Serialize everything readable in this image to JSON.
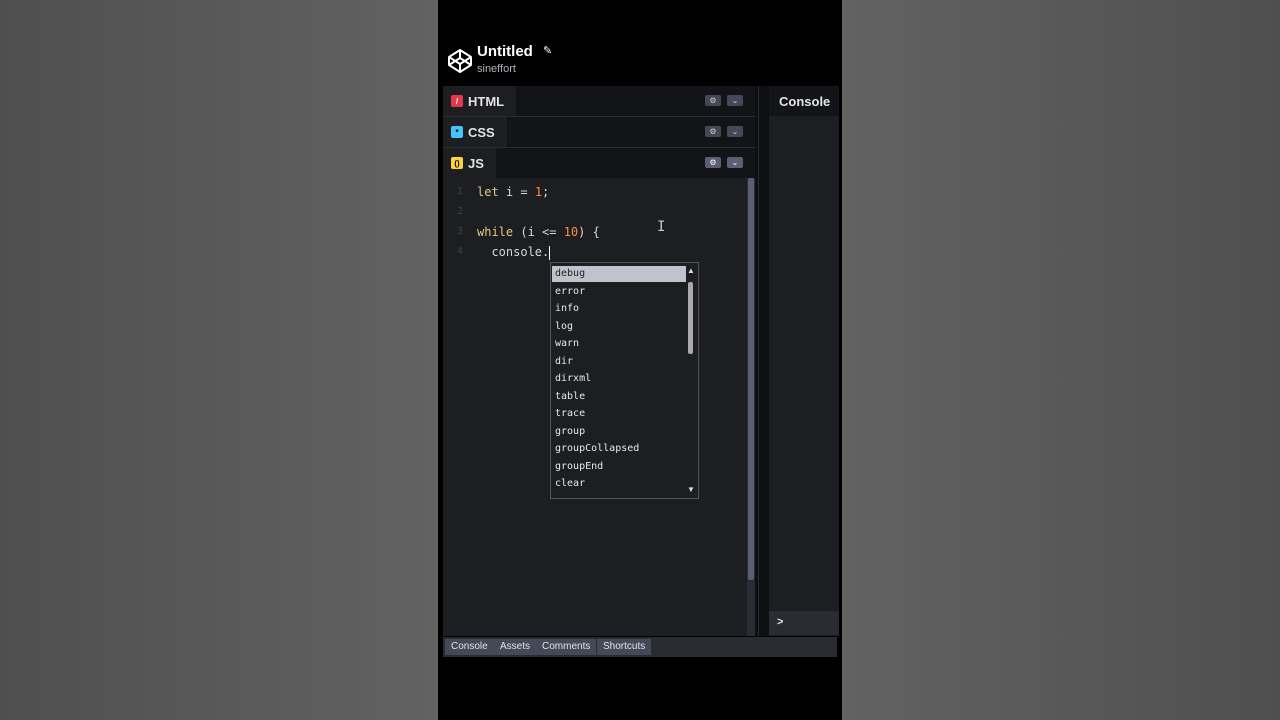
{
  "header": {
    "title": "Untitled",
    "username": "sineffort"
  },
  "tabs": [
    {
      "label": "HTML",
      "badge": "/"
    },
    {
      "label": "CSS",
      "badge": "*"
    },
    {
      "label": "JS",
      "badge": "()"
    }
  ],
  "code": {
    "line_numbers": [
      "1",
      "2",
      "3",
      "4"
    ],
    "line1": {
      "kw": "let",
      "rest": " i = ",
      "num": "1",
      "end": ";"
    },
    "line3": {
      "kw": "while",
      "rest": " (i <= ",
      "num": "10",
      "end": ") {"
    },
    "line4": {
      "text": "  console."
    }
  },
  "autocomplete": {
    "items": [
      "debug",
      "error",
      "info",
      "log",
      "warn",
      "dir",
      "dirxml",
      "table",
      "trace",
      "group",
      "groupCollapsed",
      "groupEnd",
      "clear"
    ],
    "selected": "debug"
  },
  "console": {
    "title": "Console",
    "prompt": ">"
  },
  "bottom_bar": {
    "console": "Console",
    "assets": "Assets",
    "comments": "Comments",
    "shortcuts": "Shortcuts"
  },
  "colors": {
    "html": "#e2374c",
    "css": "#47c4ff",
    "js": "#ffd43b",
    "keyword": "#ddca7e",
    "number": "#ff8d41"
  }
}
